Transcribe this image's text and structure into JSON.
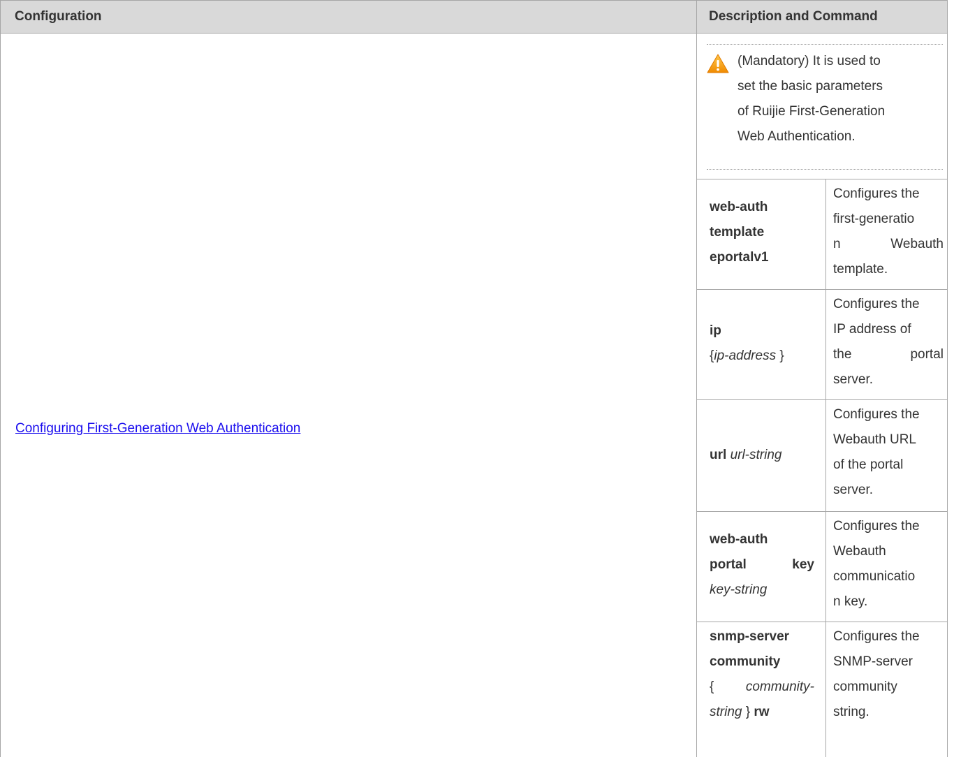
{
  "header": {
    "col1": "Configuration",
    "col2": "Description and Command"
  },
  "left": {
    "link": "Configuring First-Generation Web Authentication"
  },
  "note": {
    "icon": "warning-icon",
    "lines": [
      "(Mandatory) It is used to",
      "set the basic parameters",
      "of Ruijie First-Generation",
      "Web Authentication."
    ]
  },
  "rows": [
    {
      "cmd": {
        "l1": "web-auth",
        "l2": "template",
        "l3": "eportalv1"
      },
      "desc": {
        "l1": "Configures the",
        "l2": "first-generatio",
        "l3a": "n",
        "l3b": "Webauth",
        "l4": "template."
      }
    },
    {
      "cmd": {
        "l1": "ip",
        "l2a": "{",
        "l2b": "ip-address",
        "l2c": "}"
      },
      "desc": {
        "l1": "Configures the",
        "l2": "IP address of",
        "l3a": "the",
        "l3b": "portal",
        "l4": "server."
      }
    },
    {
      "cmd": {
        "l1a": "url",
        "l1b": "url-string"
      },
      "desc": {
        "l1": "Configures the",
        "l2": "Webauth URL",
        "l3": "of the portal",
        "l4": "server."
      }
    },
    {
      "cmd": {
        "l1": "web-auth",
        "l2a": "portal",
        "l2b": "key",
        "l3": "key-string"
      },
      "desc": {
        "l1": "Configures the",
        "l2": "Webauth",
        "l3": "communicatio",
        "l4": "n key."
      }
    },
    {
      "cmd": {
        "l1": "snmp-server",
        "l2": "community",
        "l3a": "{",
        "l3b": "community-",
        "l4a": "string",
        "l4b": "}",
        "l4c": "rw"
      },
      "desc": {
        "l1": "Configures the",
        "l2": "SNMP-server",
        "l3": "community",
        "l4": "string."
      }
    }
  ],
  "colors": {
    "header_bg": "#d9d9d9",
    "border": "#a6a6a6",
    "link": "#1a0dee",
    "text": "#333333",
    "warning": "#f5a623"
  }
}
